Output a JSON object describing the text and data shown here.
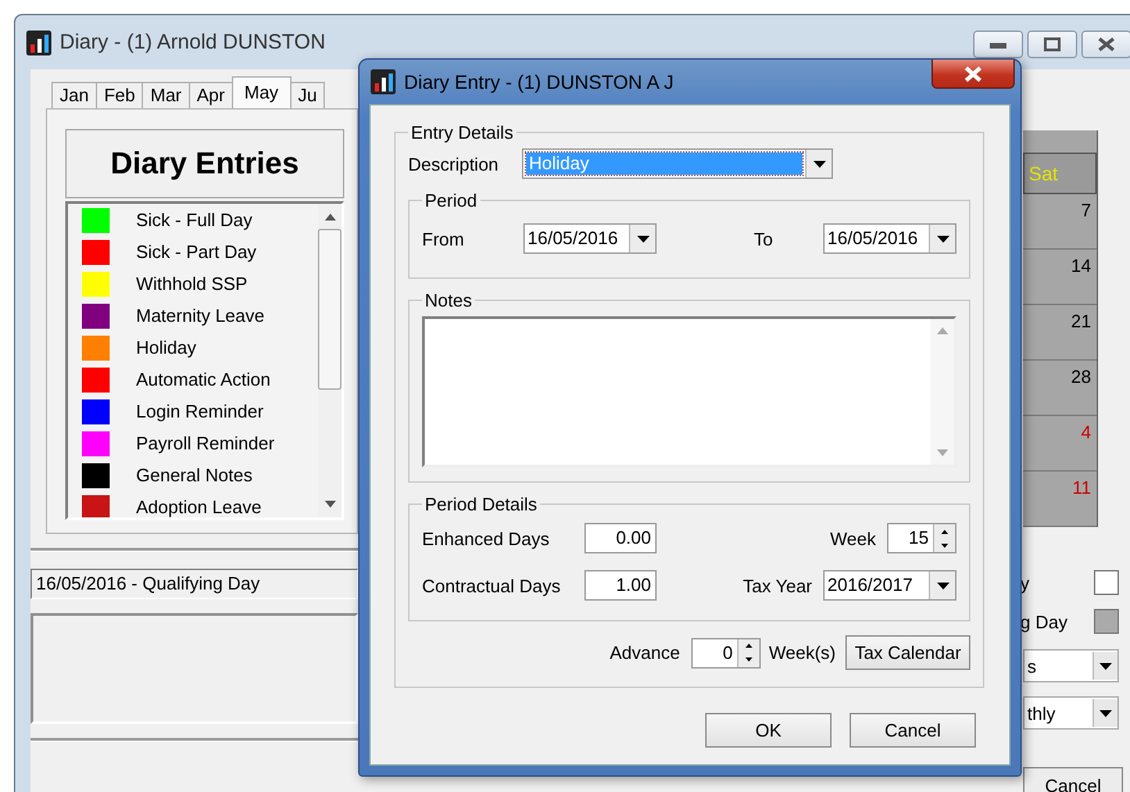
{
  "main_window": {
    "title": "Diary - (1) Arnold DUNSTON",
    "month_tabs": [
      {
        "label": "Jan",
        "selected": false
      },
      {
        "label": "Feb",
        "selected": false
      },
      {
        "label": "Mar",
        "selected": false
      },
      {
        "label": "Apr",
        "selected": false
      },
      {
        "label": "May",
        "selected": true
      },
      {
        "label": "Ju",
        "selected": false
      }
    ],
    "legend_title": "Diary Entries",
    "entry_types": [
      {
        "label": "Sick - Full Day",
        "color": "#00ff00"
      },
      {
        "label": "Sick - Part Day",
        "color": "#ff0000"
      },
      {
        "label": "Withhold SSP",
        "color": "#ffff00"
      },
      {
        "label": "Maternity Leave",
        "color": "#800080"
      },
      {
        "label": "Holiday",
        "color": "#ff8000"
      },
      {
        "label": "Automatic Action",
        "color": "#ff0000"
      },
      {
        "label": "Login Reminder",
        "color": "#0000ff"
      },
      {
        "label": "Payroll Reminder",
        "color": "#ff00ff"
      },
      {
        "label": "General Notes",
        "color": "#000000"
      },
      {
        "label": "Adoption Leave",
        "color": "#c81414"
      }
    ],
    "selected_day_text": "16/05/2016 - Qualifying Day",
    "calendar": {
      "header": "Sat",
      "days": [
        {
          "day": "7",
          "kind": "current"
        },
        {
          "day": "14",
          "kind": "current"
        },
        {
          "day": "21",
          "kind": "current"
        },
        {
          "day": "28",
          "kind": "current"
        },
        {
          "day": "4",
          "kind": "next"
        },
        {
          "day": "11",
          "kind": "next"
        }
      ]
    },
    "checkboxes": [
      {
        "label": "y",
        "disabled": false
      },
      {
        "label": "g Day",
        "disabled": true
      }
    ],
    "dropdowns": [
      {
        "value": "s"
      },
      {
        "value": "thly"
      }
    ],
    "cancel_button": "Cancel"
  },
  "dialog": {
    "title": "Diary Entry - (1) DUNSTON A J",
    "entry_details": {
      "legend": "Entry Details",
      "description_label": "Description",
      "description": "Holiday"
    },
    "period": {
      "legend": "Period",
      "from_label": "From",
      "from": "16/05/2016",
      "to_label": "To",
      "to": "16/05/2016"
    },
    "notes": {
      "legend": "Notes"
    },
    "period_details": {
      "legend": "Period Details",
      "enhanced_label": "Enhanced Days",
      "enhanced": "0.00",
      "week_label": "Week",
      "week": "15",
      "contractual_label": "Contractual Days",
      "contractual": "1.00",
      "tax_year_label": "Tax Year",
      "tax_year": "2016/2017"
    },
    "advance": {
      "label": "Advance",
      "value": "0",
      "unit": "Week(s)"
    },
    "tax_calendar_button": "Tax Calendar",
    "buttons": [
      "OK",
      "Cancel"
    ]
  }
}
